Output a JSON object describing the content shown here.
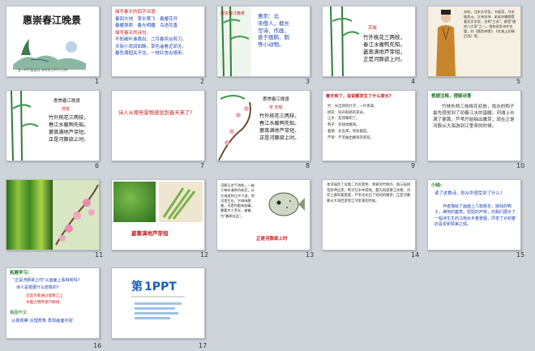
{
  "slides": [
    {
      "n": "1",
      "title": "惠崇春江晚景",
      "footer": "第一PPT模板网-WWW.1PPT.COM"
    },
    {
      "n": "2",
      "head1": "描写春天的四字词语:",
      "words": [
        "春回大地",
        "草长莺飞",
        "春暖花开",
        "春暖燕燕",
        "春光明媚",
        "鸟语花香"
      ],
      "head2": "描写春天的诗句:",
      "lines": [
        "不知细叶谁裁出，二月春风似剪刀。",
        "天街小雨润如酥，草色遥看近却无。",
        "春色满园关不住，一枝红杏出墙来。"
      ]
    },
    {
      "n": "3",
      "tag": "惠崇春江晚景",
      "author": "苏轼",
      "bio": [
        "惠崇：北",
        "宋僧人，擅长",
        "写诗、作画，",
        "善于画鹅、鹅",
        "等小动物。"
      ],
      "poem": [
        "竹外桃花三两枝，",
        "春江水暖鸭先知。",
        "蒌蒿满地芦芽短，",
        "正是河豚欲上时。"
      ]
    },
    {
      "n": "4"
    },
    {
      "n": "5",
      "bio": "苏轼，北宋文学家，书画家，号东坡居士。父亲苏洵、弟弟苏辙都是著名文学家，合称\"三苏\"，都是\"唐宋八大家\"之一。他有很多诗作名篇，如《题西林壁》、《饮湖上初晴后雨》等。"
    },
    {
      "n": "6",
      "tag": "惠崇春江晚景",
      "author": "苏轼",
      "poem": [
        "竹外桃花三两枝，",
        "春江水暖鸭先知。",
        "蒌蒿满地芦芽短，",
        "正是河豚欲上时。"
      ]
    },
    {
      "n": "7",
      "question": "诗人从哪些景物感觉到春天来了?"
    },
    {
      "n": "8",
      "tag": "惠崇春江晚景",
      "author": "宋 苏轼",
      "poem": [
        "竹外桃花三两枝，",
        "春江水暖鸭先知。",
        "蒌蒿满地芦芽短，",
        "正是河豚欲上时。"
      ]
    },
    {
      "n": "9",
      "head": "春天到了，说说都发生了什么变化?",
      "items": [
        "竹：长出新的叶子，一片青翠。",
        "桃花：绽开鲜艳的花朵。",
        "江水：变得暖和了。",
        "鸭子：欢快地嬉戏。",
        "蒌蒿：长出来，到处都是。",
        "芦芽：芦苇抽出嫩芽的芽苞。"
      ]
    },
    {
      "n": "10",
      "head": "根据注释，理解诗意",
      "text": "竹林外两三枝桃花初放，戏水的鸭子最先感觉到了初春江水的温暖。河滩上长满了蒌蒿，芦苇开始抽出嫩芽；现在正是河豚从大海游到江里来的时候。"
    },
    {
      "n": "11"
    },
    {
      "n": "12",
      "caption": "蒌蒿满地芦芽短"
    },
    {
      "n": "13",
      "text": "河豚又名气泡鱼，一般于每年清明节前后，从大海游到江中下游，到河里生长。它肉味鲜美，可是内脏有剧毒，需要专人烹饪，被誉为\"春季佳品\"。",
      "caption": "正是河豚欲上时"
    },
    {
      "n": "14",
      "text": "本诗描绘了早春二月的景色：青翠的竹林外，两三枝桃花斜伸出来；鸭子在水中游戏，最先知道春江水暖；河岸上遍布着蒌蒿，芦苇也长出了短短的嫩芽；正是河豚要从大海回游到江河里来的时候。"
    },
    {
      "n": "15",
      "head": "小结:",
      "q": "读了这首诗，你从中感受到了什么?",
      "text": "作者描绘了画面上几枝桃花，嬉戏的鸭子，满地的蒌蒿，短短的芦芽，向我们展示了一幅诗生生的江南水乡春景图，抒发了对初春的喜爱和赞美之情。"
    },
    {
      "n": "16",
      "head": "拓展学习:",
      "q1": "\"正是河豚欲上时\"从画面上看得到吗?",
      "q2": "诗人是根据什么想象的?",
      "ans1": "这是作者通过观察江上",
      "ans2": "水暖之物所进行联想。",
      "h2": "看图作文:",
      "tips": "认真观察  合理想象  再现画面内容"
    },
    {
      "n": "17",
      "logo1": "第",
      "logo2": "1PPT"
    }
  ]
}
